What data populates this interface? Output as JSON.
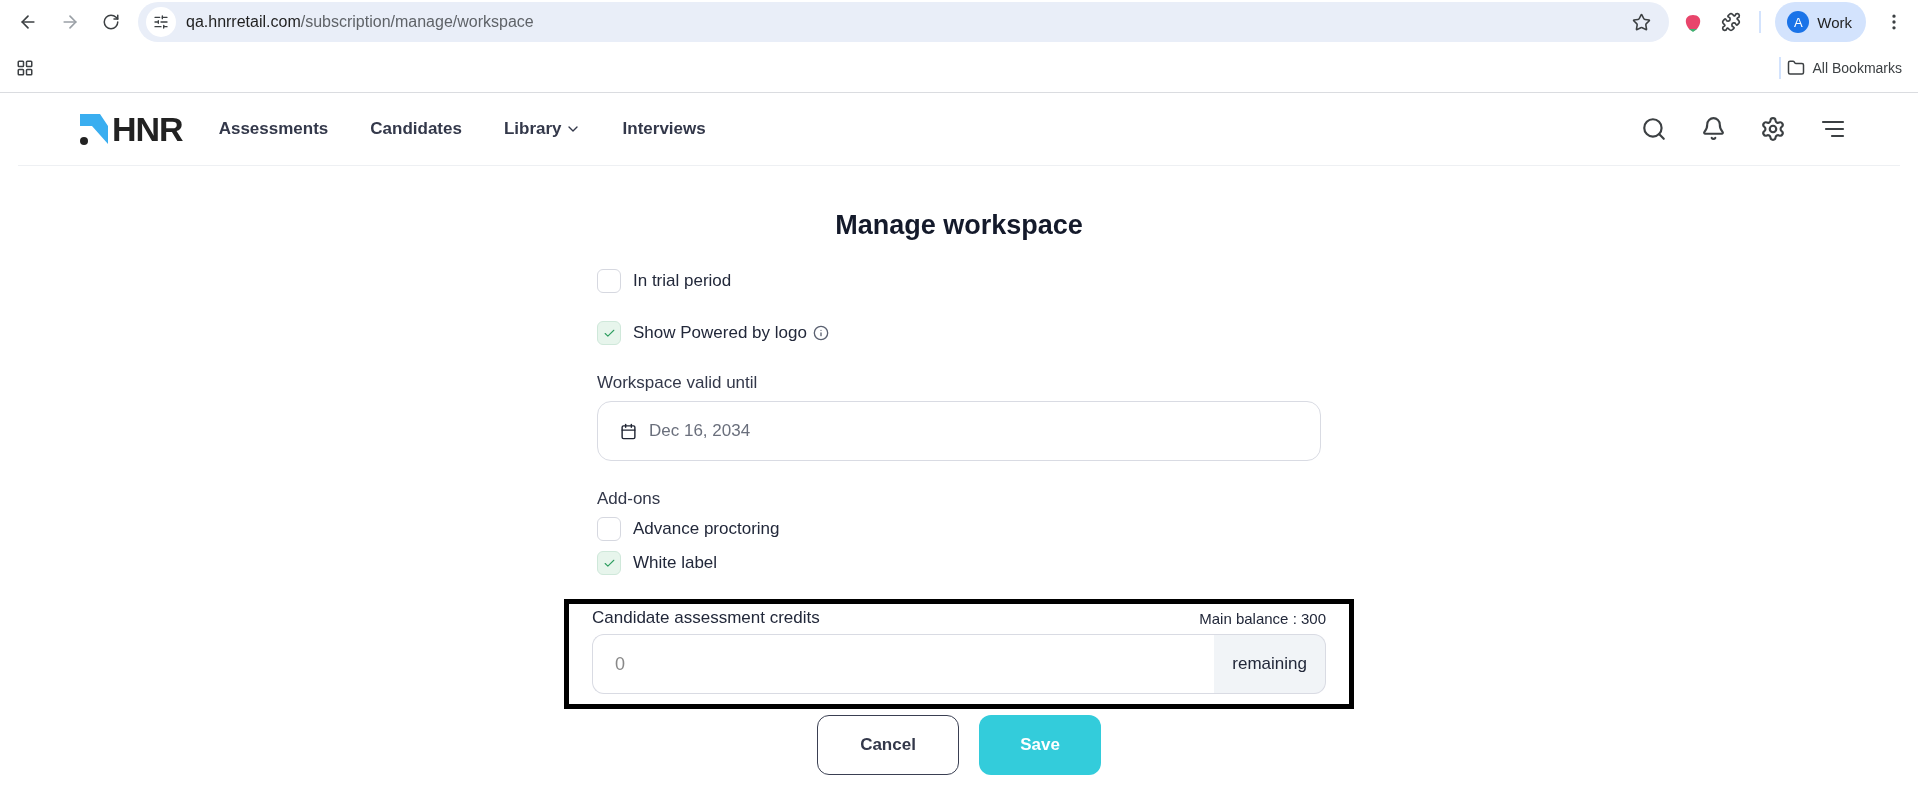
{
  "browser": {
    "url_host": "qa.hnrretail.com",
    "url_path": "/subscription/manage/workspace",
    "profile": {
      "initial": "A",
      "label": "Work"
    },
    "bookmarks_label": "All Bookmarks"
  },
  "nav": {
    "logo": "HNR",
    "items": [
      {
        "label": "Assessments",
        "dropdown": false
      },
      {
        "label": "Candidates",
        "dropdown": false
      },
      {
        "label": "Library",
        "dropdown": true
      },
      {
        "label": "Interviews",
        "dropdown": false
      }
    ]
  },
  "form": {
    "title": "Manage workspace",
    "options": [
      {
        "label": "In trial period",
        "checked": false,
        "info": false
      },
      {
        "label": "Show Powered by logo",
        "checked": true,
        "info": true
      }
    ],
    "valid_until": {
      "label": "Workspace valid until",
      "value": "Dec 16, 2034"
    },
    "addons": {
      "label": "Add-ons",
      "items": [
        {
          "label": "Advance proctoring",
          "checked": false
        },
        {
          "label": "White label",
          "checked": true
        }
      ]
    },
    "credits": {
      "label": "Candidate assessment credits",
      "balance": "Main balance : 300",
      "value": "0",
      "suffix": "remaining",
      "highlighted": true
    },
    "buttons": [
      {
        "label": "Cancel",
        "kind": "secondary"
      },
      {
        "label": "Save",
        "kind": "primary"
      }
    ]
  }
}
